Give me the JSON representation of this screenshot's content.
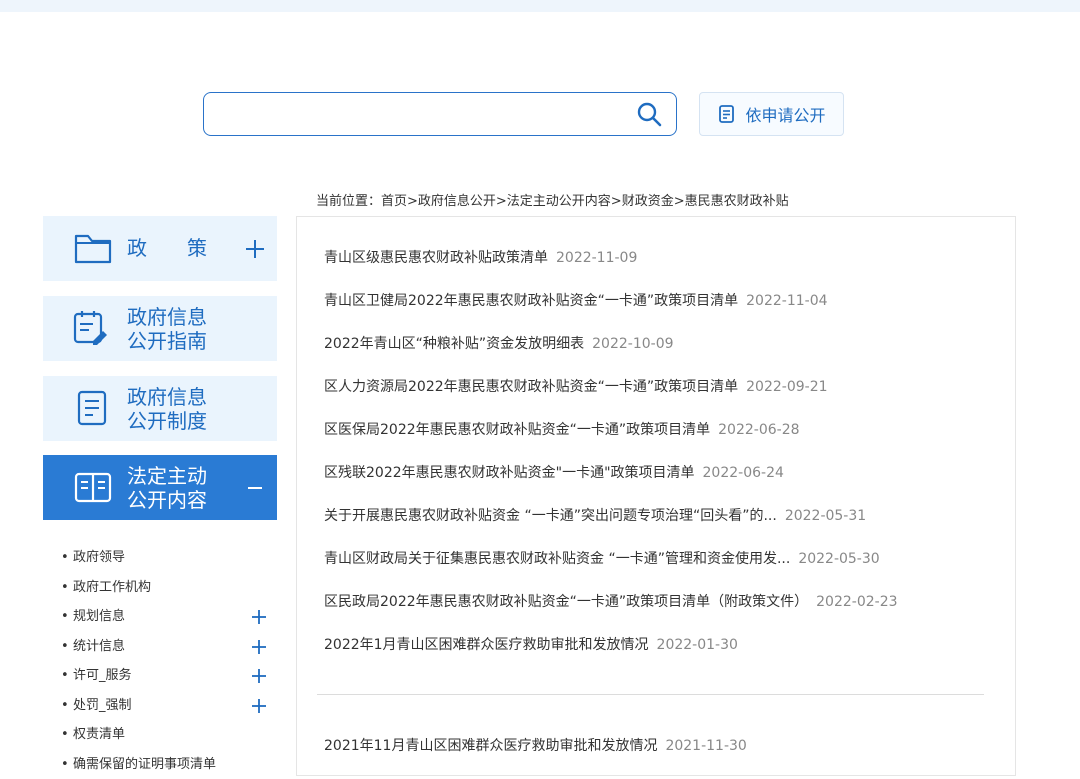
{
  "search": {
    "placeholder": "",
    "apply_label": "依申请公开"
  },
  "breadcrumb": {
    "prefix": "当前位置：",
    "path": "首页>政府信息公开>法定主动公开内容>财政资金>惠民惠农财政补贴"
  },
  "sidebar": {
    "policy": {
      "label": "政　　策"
    },
    "guide": {
      "line1": "政府信息",
      "line2": "公开指南"
    },
    "system": {
      "line1": "政府信息",
      "line2": "公开制度"
    },
    "statutory": {
      "line1": "法定主动",
      "line2": "公开内容"
    },
    "sub_items": [
      {
        "label": "政府领导",
        "expandable": false
      },
      {
        "label": "政府工作机构",
        "expandable": false
      },
      {
        "label": "规划信息",
        "expandable": true
      },
      {
        "label": "统计信息",
        "expandable": true
      },
      {
        "label": "许可_服务",
        "expandable": true
      },
      {
        "label": "处罚_强制",
        "expandable": true
      },
      {
        "label": "权责清单",
        "expandable": false
      },
      {
        "label": "确需保留的证明事项清单",
        "expandable": false
      }
    ]
  },
  "news": [
    {
      "title": "青山区级惠民惠农财政补贴政策清单",
      "date": "2022-11-09"
    },
    {
      "title": "青山区卫健局2022年惠民惠农财政补贴资金“一卡通”政策项目清单",
      "date": "2022-11-04"
    },
    {
      "title": "2022年青山区“种粮补贴”资金发放明细表",
      "date": "2022-10-09"
    },
    {
      "title": "区人力资源局2022年惠民惠农财政补贴资金“一卡通”政策项目清单",
      "date": "2022-09-21"
    },
    {
      "title": "区医保局2022年惠民惠农财政补贴资金“一卡通”政策项目清单",
      "date": "2022-06-28"
    },
    {
      "title": "区残联2022年惠民惠农财政补贴资金\"一卡通\"政策项目清单",
      "date": "2022-06-24"
    },
    {
      "title": "关于开展惠民惠农财政补贴资金 “一卡通”突出问题专项治理“回头看”的...",
      "date": "2022-05-31"
    },
    {
      "title": "青山区财政局关于征集惠民惠农财政补贴资金 “一卡通”管理和资金使用发...",
      "date": "2022-05-30"
    },
    {
      "title": "区民政局2022年惠民惠农财政补贴资金“一卡通”政策项目清单（附政策文件）",
      "date": "2022-02-23"
    },
    {
      "title": "2022年1月青山区困难群众医疗救助审批和发放情况",
      "date": "2022-01-30"
    }
  ],
  "news2": [
    {
      "title": "2021年11月青山区困难群众医疗救助审批和发放情况",
      "date": "2021-11-30"
    }
  ],
  "colors": {
    "accent": "#1f6cc0",
    "active_bg": "#2a7bd4",
    "card_bg": "#eaf4fd"
  }
}
